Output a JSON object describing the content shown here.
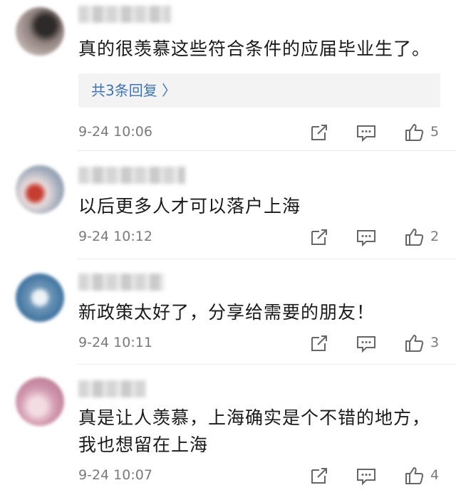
{
  "comments": [
    {
      "text_lines": [
        "真的很羡慕这些符合条件的应届毕业生了。"
      ],
      "reply_link": "共3条回复 〉",
      "time": "9-24 10:06",
      "likes": "5",
      "avatar_colors": [
        "#9a8a86",
        "#3a2f2f"
      ]
    },
    {
      "text_lines": [
        "以后更多人才可以落户上海"
      ],
      "time": "9-24 10:12",
      "likes": "2",
      "avatar_colors": [
        "#a8b4c4",
        "#d24a3c"
      ]
    },
    {
      "text_lines": [
        "新政策太好了，分享给需要的朋友！"
      ],
      "time": "9-24 10:11",
      "likes": "3",
      "avatar_colors": [
        "#4d7ea8",
        "#e7eef4"
      ]
    },
    {
      "text_lines": [
        "真是让人羡慕，上海确实是个不错的地方，",
        "我也想留在上海"
      ],
      "time": "9-24 10:07",
      "likes": "4",
      "avatar_colors": [
        "#c98ea6",
        "#f0d6de"
      ]
    }
  ],
  "icons": {
    "share": "share-icon",
    "comment": "comment-icon",
    "like": "thumbs-up-icon"
  },
  "colors": {
    "link": "#3d74b8",
    "meta_text": "#7a7a7a",
    "reply_bg": "#f3f3f3"
  }
}
